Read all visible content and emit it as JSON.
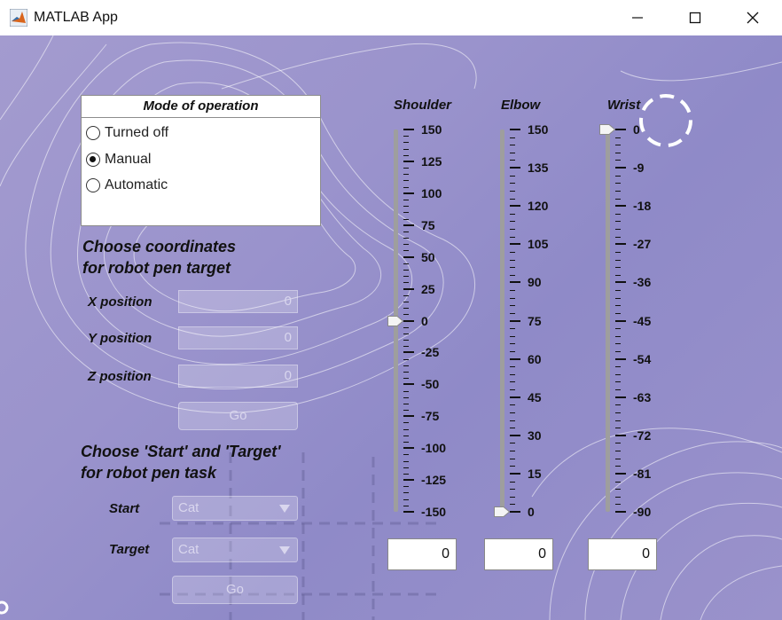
{
  "window": {
    "title": "MATLAB App"
  },
  "mode_panel": {
    "title": "Mode of operation",
    "options": [
      {
        "label": "Turned off",
        "selected": false
      },
      {
        "label": "Manual",
        "selected": true
      },
      {
        "label": "Automatic",
        "selected": false
      }
    ]
  },
  "coordinates": {
    "heading": "Choose coordinates\nfor robot pen target",
    "x_label": "X position",
    "x_value": "0",
    "y_label": "Y position",
    "y_value": "0",
    "z_label": "Z position",
    "z_value": "0",
    "go_label": "Go"
  },
  "task": {
    "heading": "Choose 'Start' and 'Target'\nfor robot pen task",
    "start_label": "Start",
    "start_value": "Cat",
    "target_label": "Target",
    "target_value": "Cat",
    "go_label": "Go"
  },
  "sliders": {
    "shoulder": {
      "label": "Shoulder",
      "min": -150,
      "max": 150,
      "value": 0,
      "ticks": [
        "150",
        "125",
        "100",
        "75",
        "50",
        "25",
        "0",
        "-25",
        "-50",
        "-75",
        "-100",
        "-125",
        "-150"
      ],
      "spinner": "0"
    },
    "elbow": {
      "label": "Elbow",
      "min": 0,
      "max": 150,
      "value": 0,
      "ticks": [
        "150",
        "135",
        "120",
        "105",
        "90",
        "75",
        "60",
        "45",
        "30",
        "15",
        "0"
      ],
      "spinner": "0"
    },
    "wrist": {
      "label": "Wrist",
      "min": -90,
      "max": 0,
      "value": 0,
      "ticks": [
        "0",
        "-9",
        "-18",
        "-27",
        "-36",
        "-45",
        "-54",
        "-63",
        "-72",
        "-81",
        "-90"
      ],
      "spinner": "0"
    }
  },
  "colors": {
    "background": "#9a93cc",
    "track": "#9e9e9e"
  }
}
